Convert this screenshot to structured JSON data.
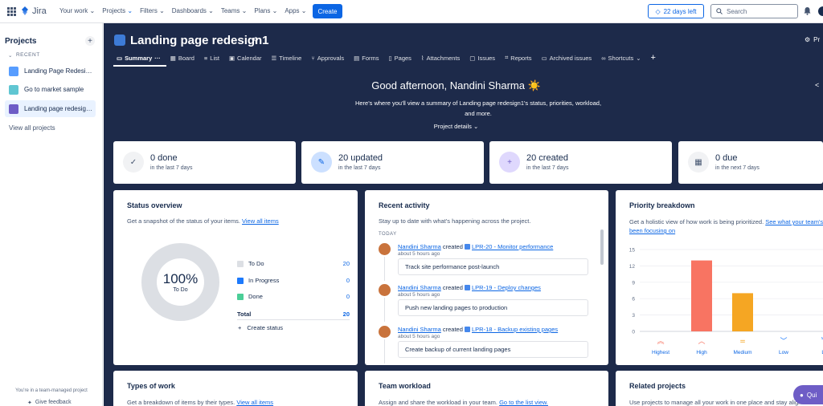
{
  "topbar": {
    "app_name": "Jira",
    "nav": [
      "Your work",
      "Projects",
      "Filters",
      "Dashboards",
      "Teams",
      "Plans",
      "Apps"
    ],
    "create_label": "Create",
    "trial_label": "22 days left",
    "search_placeholder": "Search"
  },
  "sidebar": {
    "title": "Projects",
    "recent_label": "RECENT",
    "items": [
      {
        "label": "Landing Page Redesign"
      },
      {
        "label": "Go to market sample"
      },
      {
        "label": "Landing page redesign1"
      }
    ],
    "view_all": "View all projects",
    "team_note": "You're in a team-managed project",
    "feedback": "Give feedback"
  },
  "project": {
    "title": "Landing page redesign1",
    "right_label": "Pr"
  },
  "tabs": [
    {
      "label": "Summary"
    },
    {
      "label": "Board"
    },
    {
      "label": "List"
    },
    {
      "label": "Calendar"
    },
    {
      "label": "Timeline"
    },
    {
      "label": "Approvals"
    },
    {
      "label": "Forms"
    },
    {
      "label": "Pages"
    },
    {
      "label": "Attachments"
    },
    {
      "label": "Issues"
    },
    {
      "label": "Reports"
    },
    {
      "label": "Archived issues"
    },
    {
      "label": "Shortcuts"
    }
  ],
  "summary": {
    "greeting": "Good afternoon, Nandini Sharma ☀️",
    "description": "Here's where you'll view a summary of Landing page redesign1's status, priorities, workload, and more.",
    "project_details": "Project details"
  },
  "stats": [
    {
      "value": "0 done",
      "sub": "in the last 7 days",
      "icon": "check-icon",
      "color": "#f1f2f4"
    },
    {
      "value": "20 updated",
      "sub": "in the last 7 days",
      "icon": "pencil-icon",
      "color": "#cce0ff"
    },
    {
      "value": "20 created",
      "sub": "in the last 7 days",
      "icon": "plus-icon",
      "color": "#dfd8fd"
    },
    {
      "value": "0 due",
      "sub": "in the next 7 days",
      "icon": "calendar-icon",
      "color": "#f1f2f4"
    }
  ],
  "status_overview": {
    "title": "Status overview",
    "desc": "Get a snapshot of the status of your items.",
    "link": "View all items",
    "percent": "100%",
    "percent_label": "To Do",
    "legend": [
      {
        "label": "To Do",
        "count": "20",
        "color": "#dcdfe4"
      },
      {
        "label": "In Progress",
        "count": "0",
        "color": "#1d7afc"
      },
      {
        "label": "Done",
        "count": "0",
        "color": "#4bce97"
      }
    ],
    "total_label": "Total",
    "total": "20",
    "create_status": "Create status"
  },
  "recent_activity": {
    "title": "Recent activity",
    "desc": "Stay up to date with what's happening across the project.",
    "today": "TODAY",
    "items": [
      {
        "user": "Nandini Sharma",
        "verb": "created",
        "issue": "LPR-20 - Monitor performance",
        "time": "about 5 hours ago",
        "summary": "Track site performance post-launch"
      },
      {
        "user": "Nandini Sharma",
        "verb": "created",
        "issue": "LPR-19 - Deploy changes",
        "time": "about 5 hours ago",
        "summary": "Push new landing pages to production"
      },
      {
        "user": "Nandini Sharma",
        "verb": "created",
        "issue": "LPR-18 - Backup existing pages",
        "time": "about 5 hours ago",
        "summary": "Create backup of current landing pages"
      }
    ]
  },
  "priority_breakdown": {
    "title": "Priority breakdown",
    "desc": "Get a holistic view of how work is being prioritized.",
    "link": "See what your team's been focusing on",
    "chart_data": {
      "type": "bar",
      "categories": [
        "Highest",
        "High",
        "Medium",
        "Low",
        "Lowest"
      ],
      "values": [
        0,
        13,
        7,
        0,
        0
      ],
      "colors": [
        "#f87462",
        "#f87462",
        "#f5a623",
        "#1d7afc",
        "#1d7afc"
      ],
      "ylim": [
        0,
        15
      ],
      "yticks": [
        0,
        3,
        6,
        9,
        12,
        15
      ],
      "category_labels": [
        "Highest",
        "High",
        "Medium",
        "Low",
        "Lo"
      ]
    }
  },
  "types_of_work": {
    "title": "Types of work",
    "desc": "Get a breakdown of items by their types.",
    "link": "View all items"
  },
  "team_workload": {
    "title": "Team workload",
    "desc": "Assign and share the workload in your team.",
    "link": "Go to the list view."
  },
  "related_projects": {
    "title": "Related projects",
    "desc": "Use projects to manage all your work in one place and stay aligned w"
  },
  "feedback_pill": "Qui"
}
